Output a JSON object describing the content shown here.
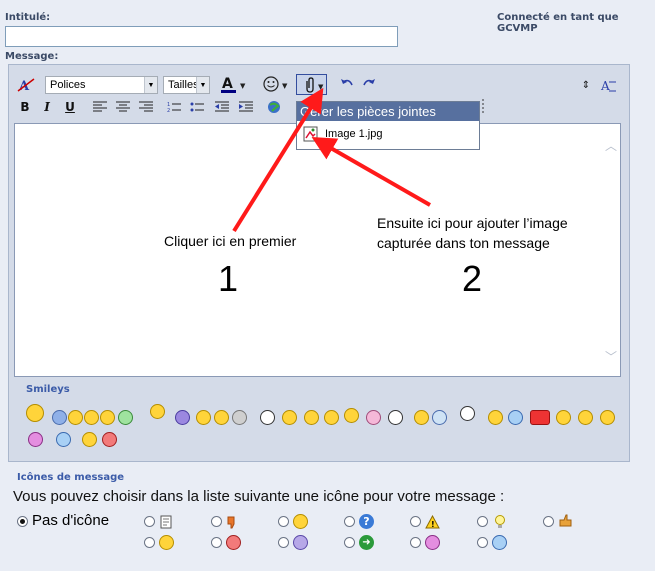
{
  "form": {
    "title_label": "Intitulé:",
    "title_value": "",
    "message_label": "Message:",
    "connected_text": "Connecté en tant que GCVMP"
  },
  "toolbar": {
    "font_select": "Polices",
    "size_select": "Tailles",
    "bold": "B",
    "italic": "I",
    "underline": "U"
  },
  "attach_menu": {
    "header": "Gérer les pièces jointes",
    "item": "Image 1.jpg"
  },
  "annotations": {
    "first": "Cliquer ici en premier",
    "first_num": "1",
    "second_line1": "Ensuite ici pour ajouter l’image",
    "second_line2": "capturée dans ton message",
    "second_num": "2"
  },
  "smileys_label": "Smileys",
  "icons_section": {
    "title": "Icônes de message",
    "instruction": "Vous pouvez choisir dans la liste suivante une icône pour votre message :",
    "no_icon": "Pas d'icône"
  },
  "colors": {
    "accent": "#57709f",
    "arrow": "#ff0000",
    "frame": "#d4dbe8"
  }
}
